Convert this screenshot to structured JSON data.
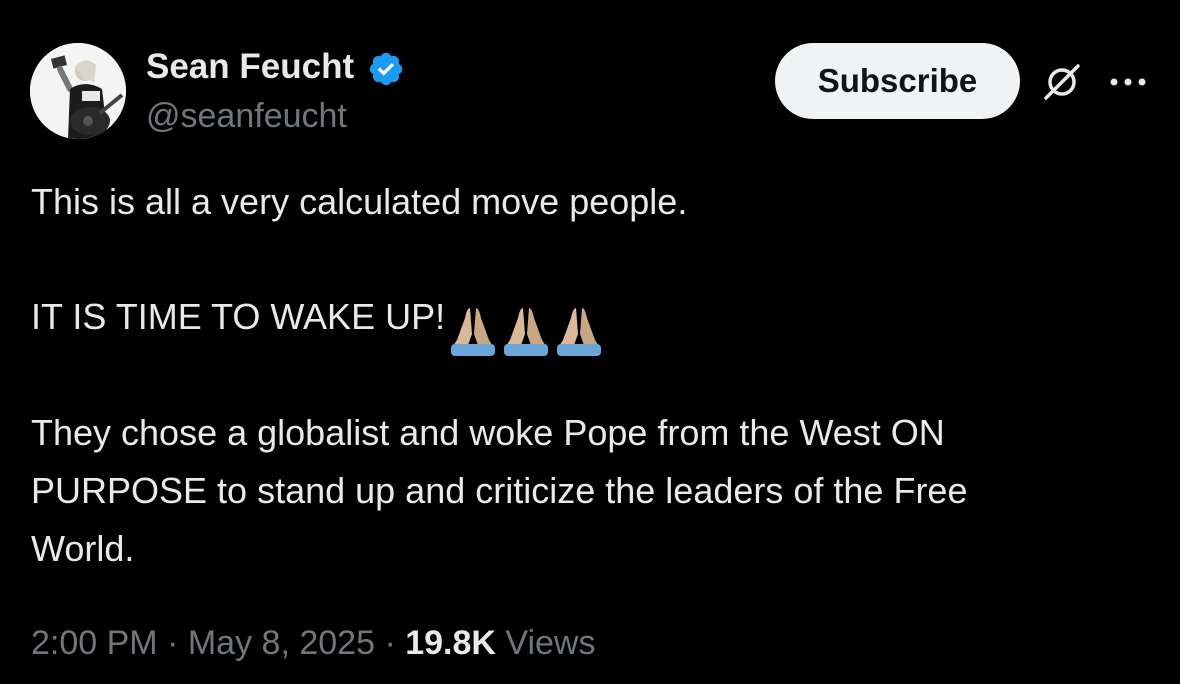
{
  "author": {
    "display_name": "Sean Feucht",
    "handle": "@seanfeucht",
    "verified": true,
    "avatar_icon": "user-avatar"
  },
  "actions": {
    "subscribe_label": "Subscribe",
    "grok_icon": "grok-icon",
    "more_icon": "more-icon"
  },
  "post": {
    "line1": "This is all a very calculated move people.",
    "line2": "IT IS TIME TO WAKE UP!",
    "line2_emoji": [
      "folded-hands-emoji",
      "folded-hands-emoji",
      "folded-hands-emoji"
    ],
    "line3": "They chose a globalist and woke Pope from the West ON",
    "line4": "PURPOSE to stand up and criticize the leaders of the Free",
    "line5": "World."
  },
  "meta": {
    "time": "2:00 PM",
    "sep1": "·",
    "date": "May 8, 2025",
    "sep2": "·",
    "views_count": "19.8K",
    "views_label": "Views"
  },
  "colors": {
    "background": "#000000",
    "primary_text": "#e7e9ea",
    "secondary_text": "#71767b",
    "verified_blue": "#1d9bf0",
    "button_bg": "#eff3f4"
  }
}
